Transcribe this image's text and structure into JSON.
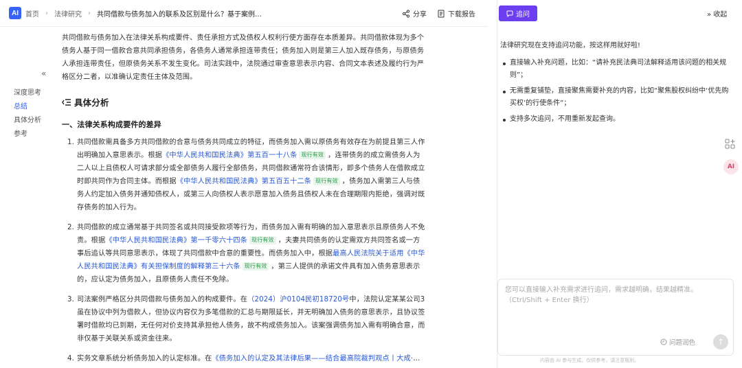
{
  "header": {
    "logo_text": "AI",
    "breadcrumb": [
      "首页",
      "法律研究",
      "共同借款与债务加入的联系及区别是什么？基于案例分..."
    ],
    "share_label": "分享",
    "download_label": "下载报告"
  },
  "toc": {
    "items": [
      "深度思考",
      "总结",
      "具体分析",
      "参考"
    ],
    "active": "总结"
  },
  "content": {
    "intro": "共同借款与债务加入在法律关系构成要件、责任承担方式及债权人权利行使方面存在本质差异。共同借款体现为多个债务人基于同一借款合意共同承担债务，各债务人通常承担连带责任；债务加入则是第三人加入既存债务，与原债务人承担连带责任，但原债务关系不发生变化。司法实践中，法院通过审查意思表示内容、合同文本表述及履约行为严格区分二者，以准确认定责任主体及范围。",
    "section_title": "具体分析",
    "subsection_title": "一、法律关系构成要件的差异",
    "items": [
      {
        "num": "1.",
        "t1": "共同借款需具备多方共同借款的合意与债务共同成立的特征，而债务加入需以原债务有效存在为前提且第三人作出明确加入意思表示。根据",
        "l1": "《中华人民共和国民法典》第五百一十八条",
        "g1": "现行有效",
        "t2": "，连带债务的成立需债务人为二人以上且债权人可请求部分或全部债务人履行全部债务，共同借款通常符合该情形，即多个债务人在借款成立时即共同作为合同主体。而根据",
        "l2": "《中华人民共和国民法典》第五百五十二条",
        "g2": "现行有效",
        "t3": "，债务加入需第三人与债务人约定加入债务并通知债权人，或第三人向债权人表示愿意加入债务且债权人未在合理期限内拒绝，强调对既存债务的加入行为。"
      },
      {
        "num": "2.",
        "t1": "共同借款的成立通常基于共同签名或共同接受款项等行为，而债务加入需有明确的加入意思表示且原债务人不免责。根据",
        "l1": "《中华人民共和国民法典》第一千零六十四条",
        "g1": "现行有效",
        "t2": "，夫妻共同债务的认定需双方共同签名或一方事后追认等共同意思表示，体现了共同借款中合意的重要性。而债务加入中，根据",
        "l2": "最高人民法院关于适用《中华人民共和国民法典》有关担保制度的解释第三十六条",
        "g2": "现行有效",
        "t3": "，第三人提供的承诺文件具有加入债务意思表示的，应认定为债务加入，且原债务人责任不免除。"
      },
      {
        "num": "3.",
        "t1": "司法案例严格区分共同借款与债务加入的构成要件。在",
        "l1": "（2024）沪0104民初18720号",
        "t2": "中，法院认定某某公司3虽在协议中列为借款人，但协议内容仅为多笔借款的汇总与期限延长，并无明确加入债务的意思表示，且协议签署时借款均已到期，无任何对价支持其承担他人债务，故不构成债务加入。该案强调债务加入需有明确合意，而非仅基于关联关系或资金往来。"
      },
      {
        "num": "4.",
        "t1": "实务文章系统分析债务加入的认定标准。在",
        "l1": "《债务加入的认定及其法律后果——结合最高院裁判观点丨大成·",
        "t2": "…"
      }
    ]
  },
  "panel": {
    "follow_label": "追问",
    "collapse_label": "收起",
    "intro": "法律研究现在支持追问功能，按这样用就好啦!",
    "tips": [
      "直接输入补充问题，比如：“请补充民法典司法解释适用该问题的相关规则”；",
      "无需重复铺垫，直接聚焦需要补充的内容，比如“聚焦股权纠纷中‘优先购买权’的行使条件”；",
      "支持多次追问，不用重新发起查询。"
    ],
    "input_placeholder": "您可以直接输入补充需求进行追问，需求越明确，结果越精准。（Ctrl/Shift + Enter 换行）",
    "polish_label": "问题润色",
    "disclaimer": "内容由 AI 参与生成，仅供参考，请注意甄别。"
  },
  "colors": {
    "accent": "#3563f5",
    "purple": "#6b3ef0",
    "link": "#2757d6"
  }
}
